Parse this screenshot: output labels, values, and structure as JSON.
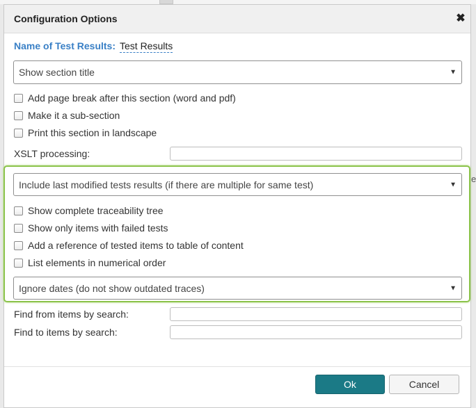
{
  "dialog": {
    "title": "Configuration Options",
    "close_icon": "close-icon",
    "close_glyph": "✖"
  },
  "name": {
    "label": "Name of Test Results:",
    "value": "Test Results"
  },
  "section_title_select": {
    "value": "Show section title"
  },
  "options": [
    {
      "label": "Add page break after this section (word and pdf)",
      "checked": false
    },
    {
      "label": "Make it a sub-section",
      "checked": false
    },
    {
      "label": "Print this section in landscape",
      "checked": false
    }
  ],
  "xslt": {
    "label": "XSLT processing:",
    "value": ""
  },
  "test_results_select": {
    "value": "Include last modified tests results (if there are multiple for same test)"
  },
  "trace_options": [
    {
      "label": "Show complete traceability tree",
      "checked": false
    },
    {
      "label": "Show only items with failed tests",
      "checked": false
    },
    {
      "label": "Add a reference of tested items to table of content",
      "checked": false
    },
    {
      "label": "List elements in numerical order",
      "checked": false
    }
  ],
  "dates_select": {
    "value": "Ignore dates (do not show outdated traces)"
  },
  "find_from": {
    "label": "Find from items by search:",
    "value": ""
  },
  "find_to": {
    "label": "Find to items by search:",
    "value": ""
  },
  "buttons": {
    "ok": "Ok",
    "cancel": "Cancel"
  },
  "colors": {
    "accent": "#1b7a86",
    "label_blue": "#3a80c6",
    "highlight_green": "#8bc34a"
  }
}
